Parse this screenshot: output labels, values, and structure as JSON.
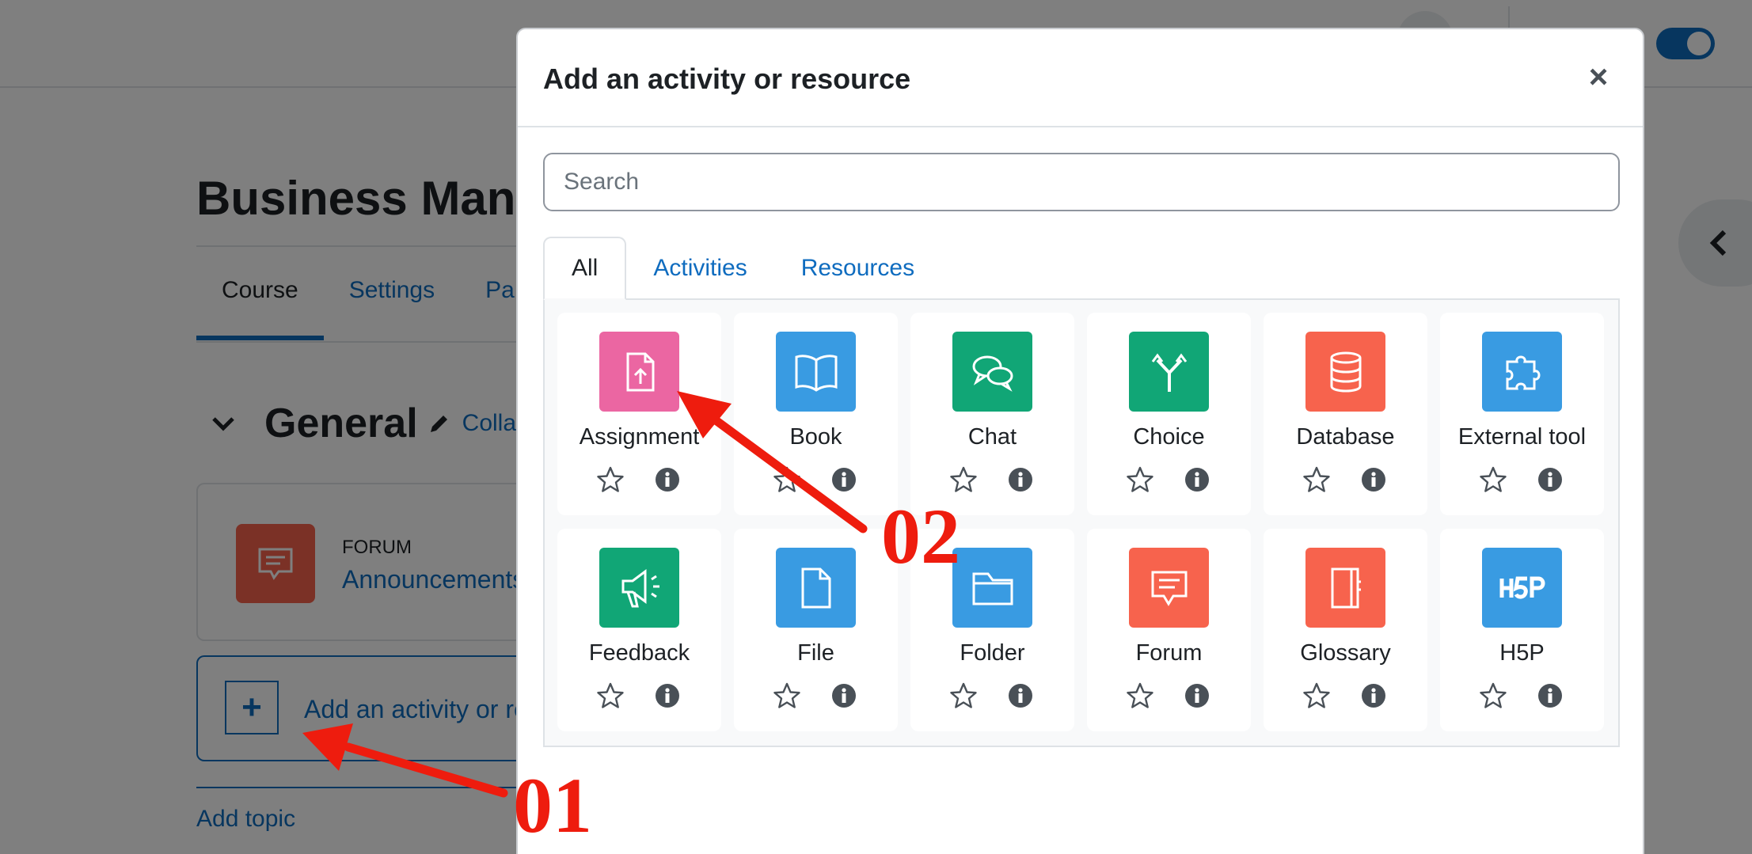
{
  "page": {
    "course_title": "Business Mana",
    "course_nav": [
      "Course",
      "Settings",
      "Pa"
    ],
    "section_title": "General",
    "collapse_link": "Collap",
    "forum_card": {
      "type": "FORUM",
      "name": "Announcements"
    },
    "add_activity_label": "Add an activity or re",
    "add_topic": "Add topic"
  },
  "modal": {
    "title": "Add an activity or resource",
    "close_glyph": "×",
    "search_placeholder": "Search",
    "tabs": [
      "All",
      "Activities",
      "Resources"
    ],
    "items": [
      {
        "label": "Assignment",
        "icon": "assignment-icon",
        "color": "#eb66a2"
      },
      {
        "label": "Book",
        "icon": "book-icon",
        "color": "#399be2"
      },
      {
        "label": "Chat",
        "icon": "chat-icon",
        "color": "#11a676"
      },
      {
        "label": "Choice",
        "icon": "choice-icon",
        "color": "#11a676"
      },
      {
        "label": "Database",
        "icon": "database-icon",
        "color": "#f7634d"
      },
      {
        "label": "External tool",
        "icon": "external-tool-icon",
        "color": "#399be2"
      },
      {
        "label": "Feedback",
        "icon": "feedback-icon",
        "color": "#11a676"
      },
      {
        "label": "File",
        "icon": "file-icon",
        "color": "#399be2"
      },
      {
        "label": "Folder",
        "icon": "folder-icon",
        "color": "#399be2"
      },
      {
        "label": "Forum",
        "icon": "forum-icon",
        "color": "#f7634d"
      },
      {
        "label": "Glossary",
        "icon": "glossary-icon",
        "color": "#f7634d"
      },
      {
        "label": "H5P",
        "icon": "h5p-icon",
        "color": "#399be2"
      }
    ]
  },
  "annotations": {
    "step1_label": "01",
    "step2_label": "02",
    "arrow_color": "#ee1c0e"
  },
  "colors": {
    "link": "#0f6cbf",
    "text": "#1d2125"
  }
}
